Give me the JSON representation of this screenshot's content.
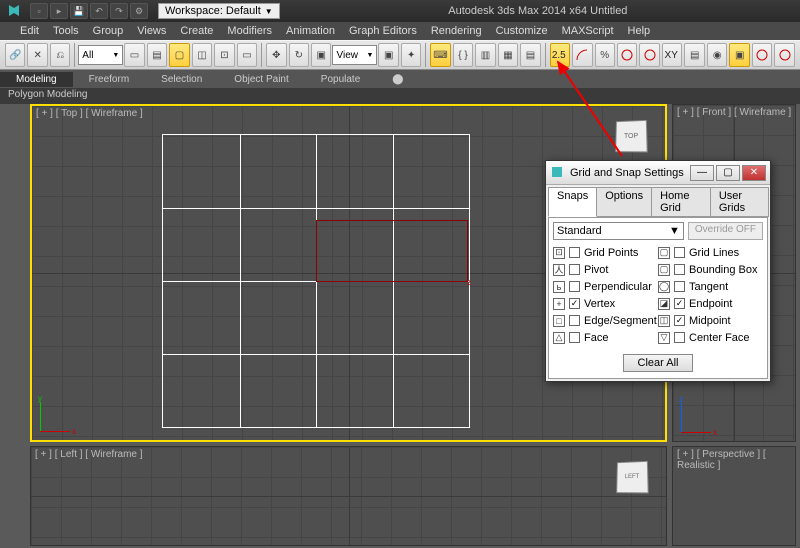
{
  "titlebar": {
    "workspace_label": "Workspace: Default",
    "app_title": "Autodesk 3ds Max 2014 x64   Untitled"
  },
  "menubar": [
    "Edit",
    "Tools",
    "Group",
    "Views",
    "Create",
    "Modifiers",
    "Animation",
    "Graph Editors",
    "Rendering",
    "Customize",
    "MAXScript",
    "Help"
  ],
  "toolbar": {
    "filter_label": "All",
    "view_label": "View",
    "snap_label": "2.5",
    "axis_label": "XY"
  },
  "ribbon": {
    "tabs": [
      "Modeling",
      "Freeform",
      "Selection",
      "Object Paint",
      "Populate"
    ],
    "sub": "Polygon Modeling"
  },
  "viewports": {
    "topleft_label": "[ + ] [ Top ] [ Wireframe ]",
    "topright_label": "[ + ] [ Front ] [ Wireframe ]",
    "botleft_label": "[ + ] [ Left ] [ Wireframe ]",
    "botright_label": "[ + ] [ Perspective ] [ Realistic ]",
    "cube_face": "TOP",
    "botleft_cube": "LEFT"
  },
  "dialog": {
    "title": "Grid and Snap Settings",
    "tabs": [
      "Snaps",
      "Options",
      "Home Grid",
      "User Grids"
    ],
    "dropdown": "Standard",
    "override": "Override OFF",
    "snaps_left": [
      {
        "label": "Grid Points",
        "checked": false,
        "icon": "⊡"
      },
      {
        "label": "Pivot",
        "checked": false,
        "icon": "人"
      },
      {
        "label": "Perpendicular",
        "checked": false,
        "icon": "ь"
      },
      {
        "label": "Vertex",
        "checked": true,
        "icon": "+"
      },
      {
        "label": "Edge/Segment",
        "checked": false,
        "icon": "□"
      },
      {
        "label": "Face",
        "checked": false,
        "icon": "△"
      }
    ],
    "snaps_right": [
      {
        "label": "Grid Lines",
        "checked": false,
        "icon": "▢"
      },
      {
        "label": "Bounding Box",
        "checked": false,
        "icon": "▢"
      },
      {
        "label": "Tangent",
        "checked": false,
        "icon": "◯"
      },
      {
        "label": "Endpoint",
        "checked": true,
        "icon": "◪"
      },
      {
        "label": "Midpoint",
        "checked": true,
        "icon": "◫"
      },
      {
        "label": "Center Face",
        "checked": false,
        "icon": "▽"
      }
    ],
    "clear": "Clear All"
  }
}
